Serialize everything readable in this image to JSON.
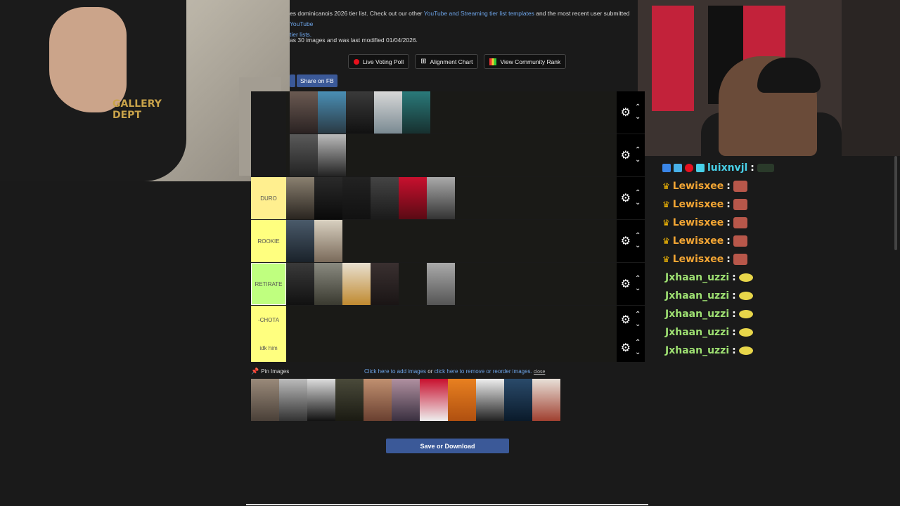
{
  "page": {
    "intro_prefix": "es dominicanois 2026 tier list. Check out our other ",
    "intro_link1": "YouTube and Streaming tier list templates",
    "intro_mid": " and the most recent user submitted ",
    "intro_link2": "YouTube",
    "intro_line2": "tier lists.",
    "meta": "as 30 images and was last modified 01/04/2026.",
    "buttons": {
      "live_poll": "Live Voting Poll",
      "alignment": "Alignment Chart",
      "community": "View Community Rank"
    },
    "share_fb": "Share on FB"
  },
  "tiers": [
    {
      "label": ""
    },
    {
      "label": ""
    },
    {
      "label": "DURO"
    },
    {
      "label": "ROOKIE"
    },
    {
      "label": "RETIRATE"
    },
    {
      "label": "-CHOTA"
    },
    {
      "label": "idk him"
    }
  ],
  "pool": {
    "pin_label": "Pin Images",
    "add_link": "Click here to add images",
    "or_text": " or ",
    "remove_link": "click here to remove or reorder images.",
    "close": "close"
  },
  "save_button": "Save or Download",
  "chat": {
    "messages": [
      {
        "user": "luixnvjl",
        "color": "blue"
      },
      {
        "user": "Lewisxee",
        "color": "orange"
      },
      {
        "user": "Lewisxee",
        "color": "orange"
      },
      {
        "user": "Lewisxee",
        "color": "orange"
      },
      {
        "user": "Lewisxee",
        "color": "orange"
      },
      {
        "user": "Lewisxee",
        "color": "orange"
      },
      {
        "user": "Jxhaan_uzzi",
        "color": "green"
      },
      {
        "user": "Jxhaan_uzzi",
        "color": "green"
      },
      {
        "user": "Jxhaan_uzzi",
        "color": "green"
      },
      {
        "user": "Jxhaan_uzzi",
        "color": "green"
      },
      {
        "user": "Jxhaan_uzzi",
        "color": "green"
      }
    ]
  },
  "colors": {
    "tier_yellow": "#ffff7f",
    "tier_yellow2": "#ffef8f",
    "tier_green": "#bfff7f",
    "fb_blue": "#3b5998",
    "link_blue": "#6da4e8"
  }
}
